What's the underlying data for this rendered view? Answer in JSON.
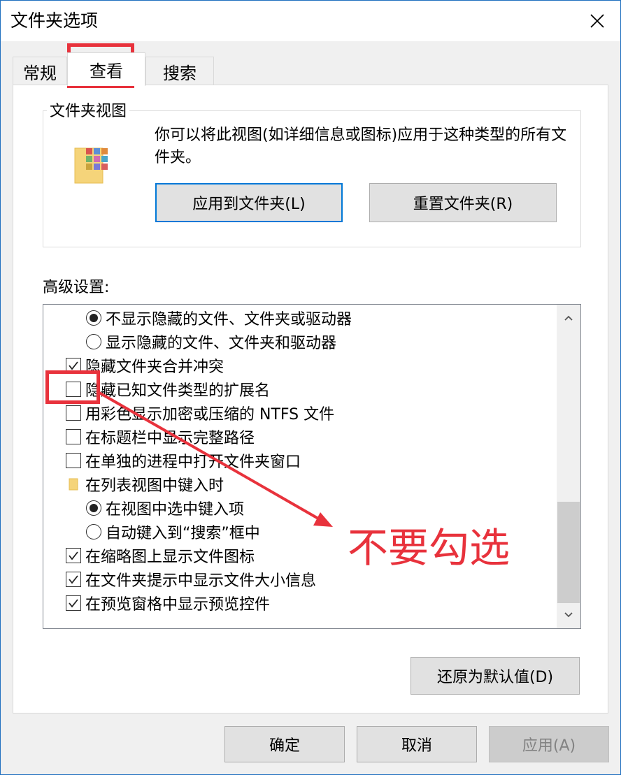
{
  "window": {
    "title": "文件夹选项",
    "close_icon": "close-icon"
  },
  "tabs": [
    {
      "label": "常规",
      "active": false
    },
    {
      "label": "查看",
      "active": true
    },
    {
      "label": "搜索",
      "active": false
    }
  ],
  "folder_views": {
    "group_title": "文件夹视图",
    "icon": "folder-pictures-icon",
    "description": "你可以将此视图(如详细信息或图标)应用于这种类型的所有文件夹。",
    "apply_button": "应用到文件夹(L)",
    "reset_button": "重置文件夹(R)"
  },
  "advanced": {
    "label": "高级设置:",
    "items": [
      {
        "kind": "radio",
        "checked": true,
        "label": "不显示隐藏的文件、文件夹或驱动器"
      },
      {
        "kind": "radio",
        "checked": false,
        "label": "显示隐藏的文件、文件夹和驱动器"
      },
      {
        "kind": "checkbox",
        "checked": true,
        "label": "隐藏文件夹合并冲突"
      },
      {
        "kind": "checkbox",
        "checked": false,
        "label": "隐藏已知文件类型的扩展名"
      },
      {
        "kind": "checkbox",
        "checked": false,
        "label": "用彩色显示加密或压缩的 NTFS 文件"
      },
      {
        "kind": "checkbox",
        "checked": false,
        "label": "在标题栏中显示完整路径"
      },
      {
        "kind": "checkbox",
        "checked": false,
        "label": "在单独的进程中打开文件夹窗口"
      },
      {
        "kind": "folder",
        "label": "在列表视图中键入时"
      },
      {
        "kind": "radio",
        "checked": true,
        "label": "在视图中选中键入项"
      },
      {
        "kind": "radio",
        "checked": false,
        "label": "自动键入到“搜索”框中"
      },
      {
        "kind": "checkbox",
        "checked": true,
        "label": "在缩略图上显示文件图标"
      },
      {
        "kind": "checkbox",
        "checked": true,
        "label": "在文件夹提示中显示文件大小信息"
      },
      {
        "kind": "checkbox",
        "checked": true,
        "label": "在预览窗格中显示预览控件"
      }
    ],
    "restore_button": "还原为默认值(D)"
  },
  "footer": {
    "ok": "确定",
    "cancel": "取消",
    "apply": "应用(A)"
  },
  "annotation": {
    "text": "不要勾选",
    "color": "#e8323c"
  }
}
